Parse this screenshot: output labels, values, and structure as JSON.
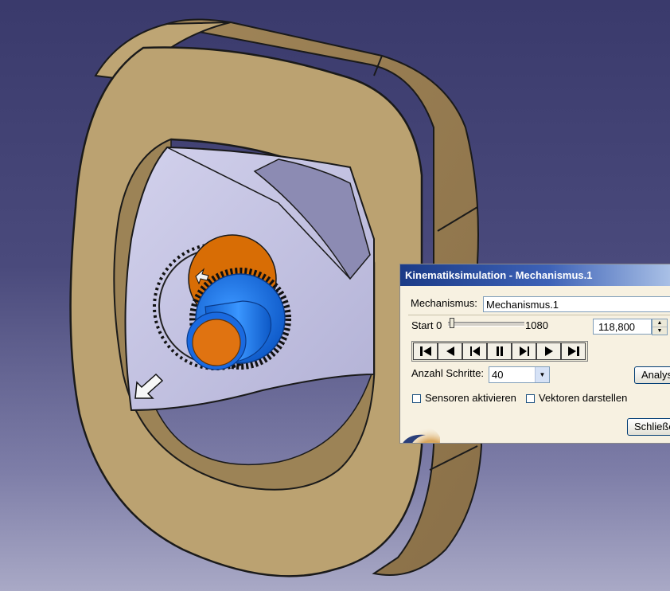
{
  "dialog": {
    "title": "Kinematiksimulation - Mechanismus.1",
    "mechanism_label": "Mechanismus:",
    "mechanism_value": "Mechanismus.1",
    "slider_start_label": "Start 0",
    "slider_end_label": "1080",
    "slider_position": 0.02,
    "current_value": "118,800",
    "steps_label": "Anzahl Schritte:",
    "steps_value": "40",
    "analysis_button": "Analyse",
    "sensors_label": "Sensoren aktivieren",
    "sensors_checked": false,
    "vectors_label": "Vektoren darstellen",
    "vectors_checked": false,
    "close_button": "Schließen"
  },
  "player_buttons": [
    {
      "name": "skip-to-start-button",
      "icon": "skip-to-start-icon"
    },
    {
      "name": "play-backward-button",
      "icon": "play-backward-icon"
    },
    {
      "name": "step-backward-button",
      "icon": "step-backward-icon"
    },
    {
      "name": "pause-button",
      "icon": "pause-icon"
    },
    {
      "name": "step-forward-button",
      "icon": "step-forward-icon"
    },
    {
      "name": "play-forward-button",
      "icon": "play-forward-icon"
    },
    {
      "name": "skip-to-end-button",
      "icon": "skip-to-end-icon"
    }
  ],
  "colors": {
    "housing": "#b9a070",
    "rotor": "#c5c4e2",
    "gear_orange": "#d86d05",
    "gear_blue": "#1570e2",
    "background_top": "#3a3a6c",
    "background_bottom": "#a9a9c6",
    "title_bar": "#1b3b87"
  }
}
